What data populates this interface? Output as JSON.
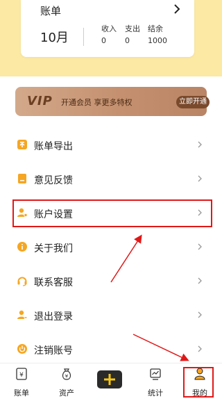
{
  "bill_card": {
    "title": "账单",
    "month": "10月",
    "stats": [
      {
        "label": "收入",
        "value": "0"
      },
      {
        "label": "支出",
        "value": "0"
      },
      {
        "label": "结余",
        "value": "1000"
      }
    ]
  },
  "vip_banner": {
    "logo": "VIP",
    "text": "开通会员 享更多特权",
    "button": "立即开通"
  },
  "menu": [
    {
      "label": "账单导出",
      "icon": "export-icon"
    },
    {
      "label": "意见反馈",
      "icon": "feedback-icon"
    },
    {
      "label": "账户设置",
      "icon": "user-settings-icon"
    },
    {
      "label": "关于我们",
      "icon": "info-icon"
    },
    {
      "label": "联系客服",
      "icon": "headset-icon"
    },
    {
      "label": "退出登录",
      "icon": "logout-user-icon"
    },
    {
      "label": "注销账号",
      "icon": "power-icon"
    }
  ],
  "tabbar": {
    "tabs": [
      {
        "label": "账单",
        "icon": "bill-icon"
      },
      {
        "label": "资产",
        "icon": "money-bag-icon"
      },
      {
        "label": "统计",
        "icon": "chart-icon"
      },
      {
        "label": "我的",
        "icon": "profile-icon",
        "active": true
      }
    ],
    "add_icon": "plus-icon"
  },
  "colors": {
    "accent": "#f5a623",
    "header_bg": "#fbe9a4",
    "vip_gradient_start": "#d3a98b",
    "vip_gradient_end": "#b98465",
    "annotation": "#e01818"
  }
}
